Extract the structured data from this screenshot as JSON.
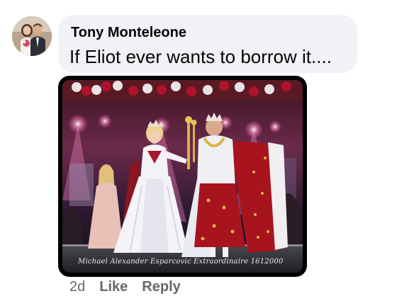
{
  "comment": {
    "author": "Tony Monteleone",
    "text": "If Eliot ever wants to borrow it....",
    "avatar": "profile-photo",
    "attachment": {
      "kind": "photo",
      "watermark": "Michael Alexander Esparcovic Extraordinaire 1612000"
    },
    "timestamp": "2d",
    "actions": {
      "like": "Like",
      "reply": "Reply"
    }
  },
  "colors": {
    "bubble": "#f0f2f5",
    "text": "#050505",
    "meta": "#65676b"
  }
}
